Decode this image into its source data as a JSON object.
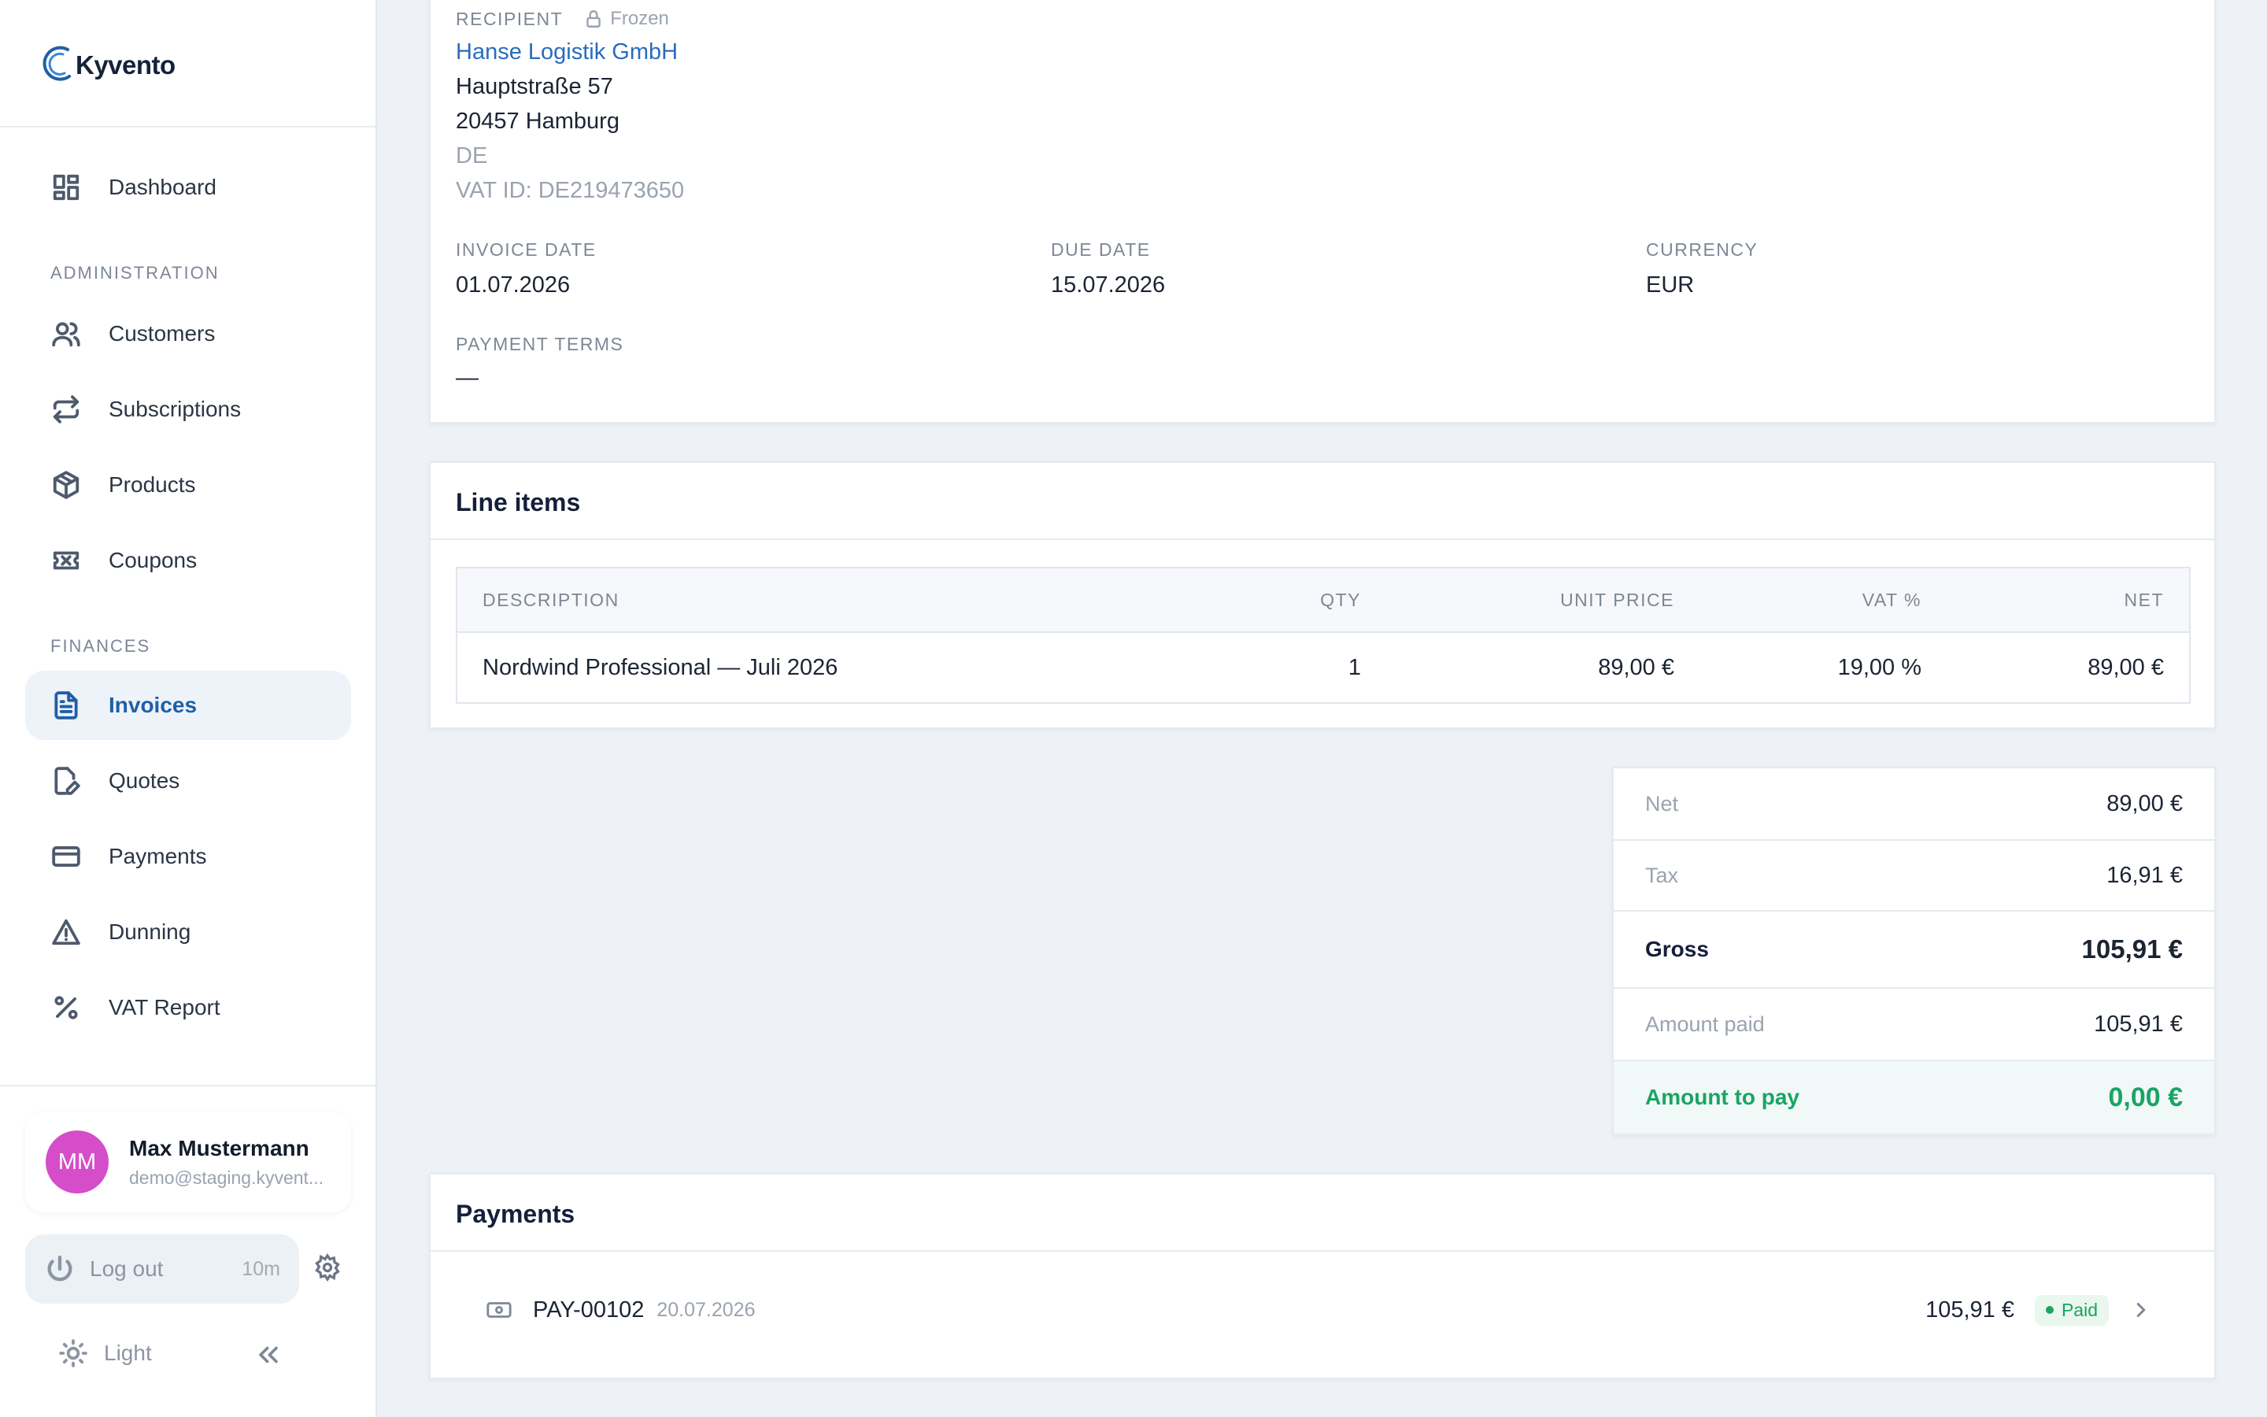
{
  "app": {
    "logo_text": "Kyvento"
  },
  "sidebar": {
    "dashboard": "Dashboard",
    "section_admin": "ADMINISTRATION",
    "admin_items": [
      "Customers",
      "Subscriptions",
      "Products",
      "Coupons"
    ],
    "section_finances": "FINANCES",
    "finance_items": [
      "Invoices",
      "Quotes",
      "Payments",
      "Dunning",
      "VAT Report"
    ],
    "active_item": "Invoices",
    "user": {
      "initials": "MM",
      "name": "Max Mustermann",
      "email": "demo@staging.kyvent..."
    },
    "logout": {
      "label": "Log out",
      "timer": "10m"
    },
    "theme": {
      "label": "Light"
    },
    "accent_color": "#1f5fa6"
  },
  "recipient": {
    "label": "RECIPIENT",
    "frozen_label": "Frozen",
    "company": "Hanse Logistik GmbH",
    "street": "Hauptstraße 57",
    "city": "20457 Hamburg",
    "country": "DE",
    "vat_id": "VAT ID: DE219473650"
  },
  "meta": {
    "invoice_date": {
      "label": "INVOICE DATE",
      "value": "01.07.2026"
    },
    "due_date": {
      "label": "DUE DATE",
      "value": "15.07.2026"
    },
    "currency": {
      "label": "CURRENCY",
      "value": "EUR"
    },
    "payment_terms": {
      "label": "PAYMENT TERMS",
      "value": "—"
    }
  },
  "line_items": {
    "title": "Line items",
    "columns": [
      "DESCRIPTION",
      "QTY",
      "UNIT PRICE",
      "VAT %",
      "NET"
    ],
    "rows": [
      {
        "description": "Nordwind Professional — Juli 2026",
        "qty": "1",
        "unit_price": "89,00 €",
        "vat": "19,00 %",
        "net": "89,00 €"
      }
    ]
  },
  "totals": {
    "net": {
      "label": "Net",
      "value": "89,00 €"
    },
    "tax": {
      "label": "Tax",
      "value": "16,91 €"
    },
    "gross": {
      "label": "Gross",
      "value": "105,91 €"
    },
    "paid": {
      "label": "Amount paid",
      "value": "105,91 €"
    },
    "to_pay": {
      "label": "Amount to pay",
      "value": "0,00 €"
    },
    "to_pay_color": "#1aa463"
  },
  "payments": {
    "title": "Payments",
    "items": [
      {
        "id": "PAY-00102",
        "date": "20.07.2026",
        "amount": "105,91 €",
        "status": "Paid"
      }
    ],
    "status_color": "#1aa463"
  }
}
